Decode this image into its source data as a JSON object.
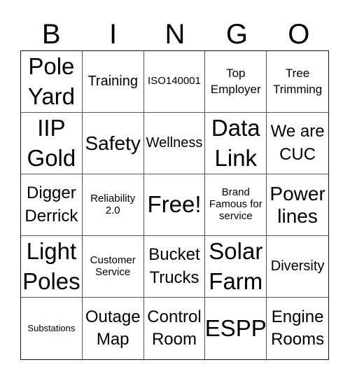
{
  "header": [
    "B",
    "I",
    "N",
    "G",
    "O"
  ],
  "cells": [
    {
      "text": "Pole Yard",
      "size": "xl"
    },
    {
      "text": "Training",
      "size": "sm"
    },
    {
      "text": "ISO140001",
      "size": "xxs"
    },
    {
      "text": "Top Employer",
      "size": "xs"
    },
    {
      "text": "Tree Trimming",
      "size": "xs"
    },
    {
      "text": "IIP Gold",
      "size": "xl"
    },
    {
      "text": "Safety",
      "size": "lg"
    },
    {
      "text": "Wellness",
      "size": "sm"
    },
    {
      "text": "Data Link",
      "size": "xl"
    },
    {
      "text": "We are CUC",
      "size": "md"
    },
    {
      "text": "Digger Derrick",
      "size": "md"
    },
    {
      "text": "Reliability 2.0",
      "size": "xxs"
    },
    {
      "text": "Free!",
      "size": "xl"
    },
    {
      "text": "Brand Famous for service",
      "size": "xxs"
    },
    {
      "text": "Power lines",
      "size": "lg"
    },
    {
      "text": "Light Poles",
      "size": "xl"
    },
    {
      "text": "Customer Service",
      "size": "xxs"
    },
    {
      "text": "Bucket Trucks",
      "size": "md"
    },
    {
      "text": "Solar Farm",
      "size": "xl"
    },
    {
      "text": "Diversity",
      "size": "sm"
    },
    {
      "text": "Substations",
      "size": "tiny"
    },
    {
      "text": "Outage Map",
      "size": "md"
    },
    {
      "text": "Control Room",
      "size": "md"
    },
    {
      "text": "ESPP",
      "size": "xl"
    },
    {
      "text": "Engine Rooms",
      "size": "md"
    }
  ]
}
